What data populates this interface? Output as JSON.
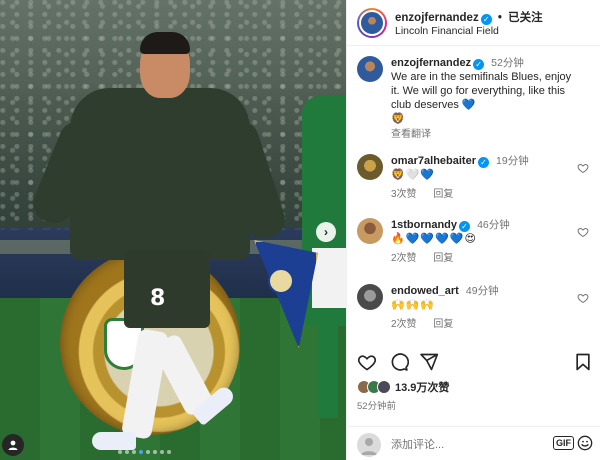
{
  "post": {
    "username": "enzojfernandez",
    "separator": "•",
    "follow_state": "已关注",
    "location": "Lincoln Financial Field",
    "photo": {
      "jersey_number": "8",
      "carousel_count": 8,
      "carousel_active_index": 3
    }
  },
  "caption": {
    "username": "enzojfernandez",
    "time": "52分钟",
    "text": "We are in the semifinals Blues, enjoy it. We will go for everything, like this club deserves 💙",
    "extra_emoji": "🦁",
    "translate_label": "查看翻译"
  },
  "comments": [
    {
      "username": "omar7alhebaiter",
      "time": "19分钟",
      "text": "🦁🤍💙",
      "likes": "3次赞",
      "reply": "回复"
    },
    {
      "username": "1stbornandy",
      "time": "46分钟",
      "text": "🔥💙💙💙💙😍",
      "likes": "2次赞",
      "reply": "回复"
    },
    {
      "username": "endowed_art",
      "time": "49分钟",
      "text": "🙌🙌🙌",
      "likes": "2次赞",
      "reply": "回复"
    }
  ],
  "actions": {
    "like_icon": "heart-icon",
    "comment_icon": "comment-icon",
    "share_icon": "share-icon",
    "save_icon": "bookmark-icon"
  },
  "likes": {
    "label": "13.9万次赞"
  },
  "posted_ago": "52分钟前",
  "add_comment": {
    "placeholder": "添加评论...",
    "gif_label": "GIF",
    "emoji_icon": "smile-icon"
  },
  "colors": {
    "verified": "#0095f6",
    "carousel_active": "#4aa3f5",
    "text": "#262626",
    "muted": "#737373"
  }
}
